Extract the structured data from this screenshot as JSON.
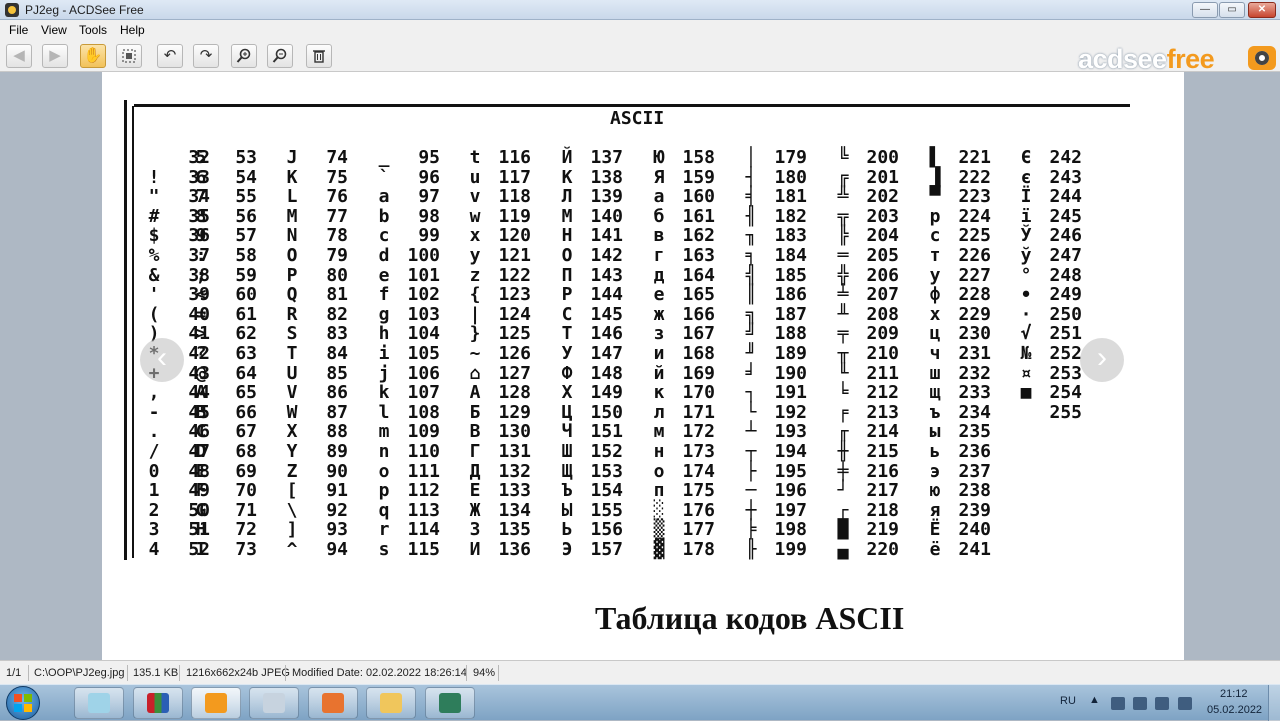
{
  "window": {
    "title": "PJ2eg - ACDSee Free"
  },
  "menu": [
    "File",
    "View",
    "Tools",
    "Help"
  ],
  "brand": {
    "word": "acdsee",
    "accent": "free",
    "accent_color": "#f39a1e"
  },
  "image": {
    "heading": "ASCII",
    "caption": "Таблица кодов ASCII",
    "columns": [
      [
        [
          "",
          "32"
        ],
        [
          "!",
          "33"
        ],
        [
          "\"",
          "34"
        ],
        [
          "#",
          "35"
        ],
        [
          "$",
          "36"
        ],
        [
          "%",
          "37"
        ],
        [
          "&",
          "38"
        ],
        [
          "'",
          "39"
        ],
        [
          "(",
          "40"
        ],
        [
          ")",
          "41"
        ],
        [
          "*",
          "42"
        ],
        [
          "+",
          "43"
        ],
        [
          ",",
          "44"
        ],
        [
          "-",
          "45"
        ],
        [
          ".",
          "46"
        ],
        [
          "/",
          "47"
        ],
        [
          "0",
          "48"
        ],
        [
          "1",
          "49"
        ],
        [
          "2",
          "50"
        ],
        [
          "3",
          "51"
        ],
        [
          "4",
          "52"
        ]
      ],
      [
        [
          "5",
          "53"
        ],
        [
          "6",
          "54"
        ],
        [
          "7",
          "55"
        ],
        [
          "8",
          "56"
        ],
        [
          "9",
          "57"
        ],
        [
          ":",
          "58"
        ],
        [
          ";",
          "59"
        ],
        [
          "<",
          "60"
        ],
        [
          "=",
          "61"
        ],
        [
          ">",
          "62"
        ],
        [
          "?",
          "63"
        ],
        [
          "@",
          "64"
        ],
        [
          "A",
          "65"
        ],
        [
          "B",
          "66"
        ],
        [
          "C",
          "67"
        ],
        [
          "D",
          "68"
        ],
        [
          "E",
          "69"
        ],
        [
          "F",
          "70"
        ],
        [
          "G",
          "71"
        ],
        [
          "H",
          "72"
        ],
        [
          "I",
          "73"
        ]
      ],
      [
        [
          "J",
          "74"
        ],
        [
          "K",
          "75"
        ],
        [
          "L",
          "76"
        ],
        [
          "M",
          "77"
        ],
        [
          "N",
          "78"
        ],
        [
          "O",
          "79"
        ],
        [
          "P",
          "80"
        ],
        [
          "Q",
          "81"
        ],
        [
          "R",
          "82"
        ],
        [
          "S",
          "83"
        ],
        [
          "T",
          "84"
        ],
        [
          "U",
          "85"
        ],
        [
          "V",
          "86"
        ],
        [
          "W",
          "87"
        ],
        [
          "X",
          "88"
        ],
        [
          "Y",
          "89"
        ],
        [
          "Z",
          "90"
        ],
        [
          "[",
          "91"
        ],
        [
          "\\",
          "92"
        ],
        [
          "]",
          "93"
        ],
        [
          "^",
          "94"
        ]
      ],
      [
        [
          "_",
          "95"
        ],
        [
          "`",
          "96"
        ],
        [
          "a",
          "97"
        ],
        [
          "b",
          "98"
        ],
        [
          "c",
          "99"
        ],
        [
          "d",
          "100"
        ],
        [
          "e",
          "101"
        ],
        [
          "f",
          "102"
        ],
        [
          "g",
          "103"
        ],
        [
          "h",
          "104"
        ],
        [
          "i",
          "105"
        ],
        [
          "j",
          "106"
        ],
        [
          "k",
          "107"
        ],
        [
          "l",
          "108"
        ],
        [
          "m",
          "109"
        ],
        [
          "n",
          "110"
        ],
        [
          "o",
          "111"
        ],
        [
          "p",
          "112"
        ],
        [
          "q",
          "113"
        ],
        [
          "r",
          "114"
        ],
        [
          "s",
          "115"
        ]
      ],
      [
        [
          "t",
          "116"
        ],
        [
          "u",
          "117"
        ],
        [
          "v",
          "118"
        ],
        [
          "w",
          "119"
        ],
        [
          "x",
          "120"
        ],
        [
          "y",
          "121"
        ],
        [
          "z",
          "122"
        ],
        [
          "{",
          "123"
        ],
        [
          "|",
          "124"
        ],
        [
          "}",
          "125"
        ],
        [
          "~",
          "126"
        ],
        [
          "⌂",
          "127"
        ],
        [
          "А",
          "128"
        ],
        [
          "Б",
          "129"
        ],
        [
          "В",
          "130"
        ],
        [
          "Г",
          "131"
        ],
        [
          "Д",
          "132"
        ],
        [
          "Е",
          "133"
        ],
        [
          "Ж",
          "134"
        ],
        [
          "З",
          "135"
        ],
        [
          "И",
          "136"
        ]
      ],
      [
        [
          "Й",
          "137"
        ],
        [
          "К",
          "138"
        ],
        [
          "Л",
          "139"
        ],
        [
          "М",
          "140"
        ],
        [
          "Н",
          "141"
        ],
        [
          "О",
          "142"
        ],
        [
          "П",
          "143"
        ],
        [
          "Р",
          "144"
        ],
        [
          "С",
          "145"
        ],
        [
          "Т",
          "146"
        ],
        [
          "У",
          "147"
        ],
        [
          "Ф",
          "148"
        ],
        [
          "Х",
          "149"
        ],
        [
          "Ц",
          "150"
        ],
        [
          "Ч",
          "151"
        ],
        [
          "Ш",
          "152"
        ],
        [
          "Щ",
          "153"
        ],
        [
          "Ъ",
          "154"
        ],
        [
          "Ы",
          "155"
        ],
        [
          "Ь",
          "156"
        ],
        [
          "Э",
          "157"
        ]
      ],
      [
        [
          "Ю",
          "158"
        ],
        [
          "Я",
          "159"
        ],
        [
          "а",
          "160"
        ],
        [
          "б",
          "161"
        ],
        [
          "в",
          "162"
        ],
        [
          "г",
          "163"
        ],
        [
          "д",
          "164"
        ],
        [
          "е",
          "165"
        ],
        [
          "ж",
          "166"
        ],
        [
          "з",
          "167"
        ],
        [
          "и",
          "168"
        ],
        [
          "й",
          "169"
        ],
        [
          "к",
          "170"
        ],
        [
          "л",
          "171"
        ],
        [
          "м",
          "172"
        ],
        [
          "н",
          "173"
        ],
        [
          "о",
          "174"
        ],
        [
          "п",
          "175"
        ],
        [
          "░",
          "176"
        ],
        [
          "▒",
          "177"
        ],
        [
          "▓",
          "178"
        ]
      ],
      [
        [
          "│",
          "179"
        ],
        [
          "┤",
          "180"
        ],
        [
          "╡",
          "181"
        ],
        [
          "╢",
          "182"
        ],
        [
          "╖",
          "183"
        ],
        [
          "╕",
          "184"
        ],
        [
          "╣",
          "185"
        ],
        [
          "║",
          "186"
        ],
        [
          "╗",
          "187"
        ],
        [
          "╝",
          "188"
        ],
        [
          "╜",
          "189"
        ],
        [
          "╛",
          "190"
        ],
        [
          "┐",
          "191"
        ],
        [
          "└",
          "192"
        ],
        [
          "┴",
          "193"
        ],
        [
          "┬",
          "194"
        ],
        [
          "├",
          "195"
        ],
        [
          "─",
          "196"
        ],
        [
          "┼",
          "197"
        ],
        [
          "╞",
          "198"
        ],
        [
          "╟",
          "199"
        ]
      ],
      [
        [
          "╚",
          "200"
        ],
        [
          "╔",
          "201"
        ],
        [
          "╩",
          "202"
        ],
        [
          "╦",
          "203"
        ],
        [
          "╠",
          "204"
        ],
        [
          "═",
          "205"
        ],
        [
          "╬",
          "206"
        ],
        [
          "╧",
          "207"
        ],
        [
          "╨",
          "208"
        ],
        [
          "╤",
          "209"
        ],
        [
          "╥",
          "210"
        ],
        [
          "╙",
          "211"
        ],
        [
          "╘",
          "212"
        ],
        [
          "╒",
          "213"
        ],
        [
          "╓",
          "214"
        ],
        [
          "╫",
          "215"
        ],
        [
          "╪",
          "216"
        ],
        [
          "┘",
          "217"
        ],
        [
          "┌",
          "218"
        ],
        [
          "█",
          "219"
        ],
        [
          "▄",
          "220"
        ]
      ],
      [
        [
          "▌",
          "221"
        ],
        [
          "▐",
          "222"
        ],
        [
          "▀",
          "223"
        ],
        [
          "р",
          "224"
        ],
        [
          "с",
          "225"
        ],
        [
          "т",
          "226"
        ],
        [
          "у",
          "227"
        ],
        [
          "ф",
          "228"
        ],
        [
          "х",
          "229"
        ],
        [
          "ц",
          "230"
        ],
        [
          "ч",
          "231"
        ],
        [
          "ш",
          "232"
        ],
        [
          "щ",
          "233"
        ],
        [
          "ъ",
          "234"
        ],
        [
          "ы",
          "235"
        ],
        [
          "ь",
          "236"
        ],
        [
          "э",
          "237"
        ],
        [
          "ю",
          "238"
        ],
        [
          "я",
          "239"
        ],
        [
          "Ё",
          "240"
        ],
        [
          "ё",
          "241"
        ]
      ],
      [
        [
          "Є",
          "242"
        ],
        [
          "є",
          "243"
        ],
        [
          "Ї",
          "244"
        ],
        [
          "ї",
          "245"
        ],
        [
          "Ў",
          "246"
        ],
        [
          "ў",
          "247"
        ],
        [
          "°",
          "248"
        ],
        [
          "∙",
          "249"
        ],
        [
          "·",
          "250"
        ],
        [
          "√",
          "251"
        ],
        [
          "№",
          "252"
        ],
        [
          "¤",
          "253"
        ],
        [
          "■",
          "254"
        ],
        [
          "",
          "255"
        ]
      ]
    ]
  },
  "statusbar": {
    "index": "1/1",
    "path": "C:\\OOP\\PJ2eg.jpg",
    "size": "135.1 KB",
    "dims": "1216x662x24b JPEG",
    "modified": "Modified Date: 02.02.2022 18:26:14",
    "zoom": "94%"
  },
  "tray": {
    "lang": "RU",
    "time": "21:12",
    "date": "05.02.2022"
  }
}
